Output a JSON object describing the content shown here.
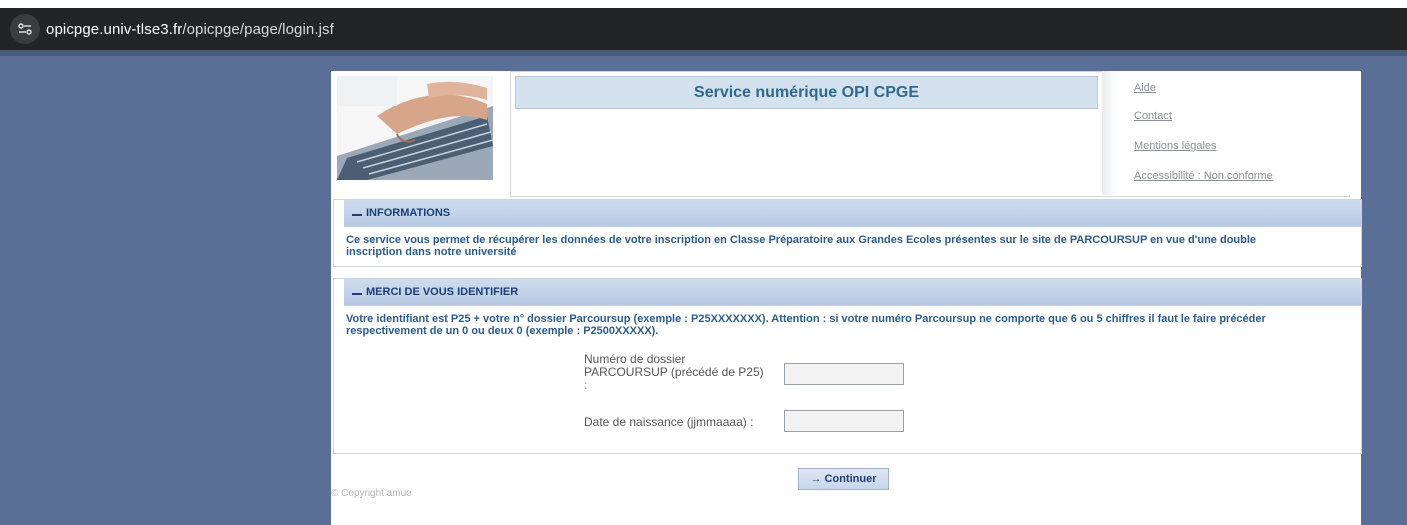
{
  "browser": {
    "url_host": "opicpge.univ-tlse3.fr",
    "url_path": "/opicpge/page/login.jsf"
  },
  "header": {
    "title": "Service numérique OPI CPGE",
    "links": [
      "Aide",
      "Contact",
      "Mentions légales",
      "Accessibilité : Non conforme"
    ]
  },
  "info_section": {
    "heading": "INFORMATIONS",
    "text": "Ce service vous permet de récupérer les données de votre inscription en Classe Préparatoire aux Grandes Ecoles présentes sur le site de PARCOURSUP en vue d'une double inscription dans notre université"
  },
  "login_section": {
    "heading": "MERCI DE VOUS IDENTIFIER",
    "text": "Votre identifiant est P25 + votre n° dossier Parcoursup (exemple : P25XXXXXXX). Attention : si votre numéro Parcoursup ne comporte que 6 ou 5 chiffres il faut le faire précéder respectivement de un 0 ou deux 0 (exemple : P2500XXXXX).",
    "dossier_label_1": "Numéro de dossier",
    "dossier_label_2": "PARCOURSUP (précédé de P25)",
    "dossier_label_3": ":",
    "dossier_value": "",
    "birth_label": "Date de naissance (jjmmaaaa) :",
    "birth_value": ""
  },
  "actions": {
    "continue_label": "→ Continuer"
  },
  "footer": {
    "copyright": "© Copyright amue"
  }
}
